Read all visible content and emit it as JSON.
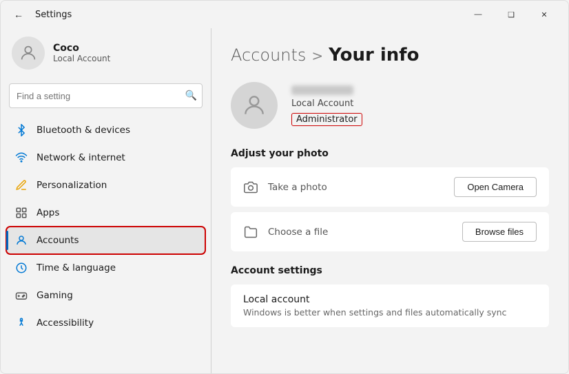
{
  "window": {
    "title": "Settings",
    "controls": {
      "minimize": "—",
      "maximize": "❑",
      "close": "✕"
    }
  },
  "sidebar": {
    "user": {
      "name": "Coco",
      "account_type": "Local Account"
    },
    "search": {
      "placeholder": "Find a setting"
    },
    "nav_items": [
      {
        "id": "bluetooth",
        "label": "Bluetooth & devices",
        "icon": "bluetooth"
      },
      {
        "id": "network",
        "label": "Network & internet",
        "icon": "network"
      },
      {
        "id": "personalization",
        "label": "Personalization",
        "icon": "personalization"
      },
      {
        "id": "apps",
        "label": "Apps",
        "icon": "apps"
      },
      {
        "id": "accounts",
        "label": "Accounts",
        "icon": "accounts",
        "active": true
      },
      {
        "id": "time",
        "label": "Time & language",
        "icon": "time"
      },
      {
        "id": "gaming",
        "label": "Gaming",
        "icon": "gaming"
      },
      {
        "id": "accessibility",
        "label": "Accessibility",
        "icon": "accessibility"
      }
    ]
  },
  "main": {
    "breadcrumb": "Accounts",
    "breadcrumb_sep": ">",
    "title": "Your info",
    "user_account_label": "Local Account",
    "user_role_label": "Administrator",
    "adjust_photo_title": "Adjust your photo",
    "take_photo_label": "Take a photo",
    "open_camera_button": "Open Camera",
    "choose_file_label": "Choose a file",
    "browse_files_button": "Browse files",
    "account_settings_title": "Account settings",
    "local_account_title": "Local account",
    "local_account_subtitle": "Windows is better when settings and files automatically sync"
  }
}
